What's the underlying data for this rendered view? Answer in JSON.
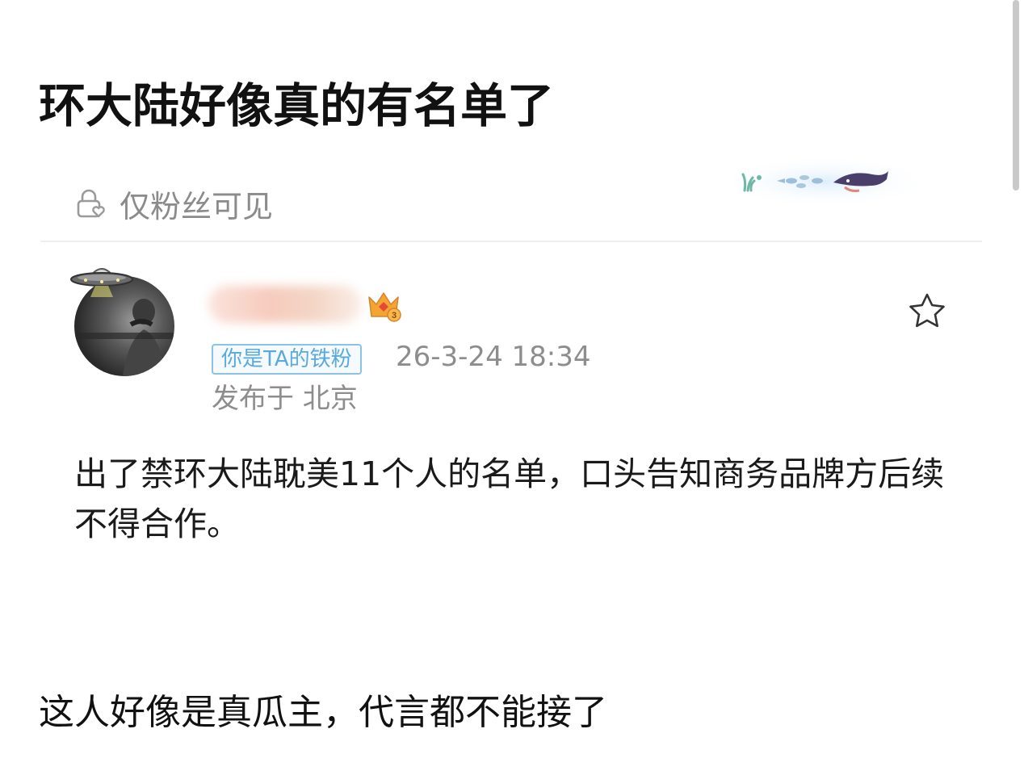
{
  "page": {
    "title": "环大陆好像真的有名单了"
  },
  "visibility": {
    "icon": "lock-heart-icon",
    "label": "仅粉丝可见"
  },
  "post": {
    "username": "",
    "fan_badge": "你是TA的铁粉",
    "timestamp": "26-3-24 18:34",
    "location": "发布于 北京",
    "body": "出了禁环大陆耽美11个人的名单，口头告知商务品牌方后续不得合作。",
    "crown_level": "3"
  },
  "caption": {
    "text": "这人好像是真瓜主，代言都不能接了"
  },
  "colors": {
    "badge_blue": "#5aa9db",
    "muted_gray": "#8d8d8d",
    "crown_gold": "#f2a531"
  }
}
